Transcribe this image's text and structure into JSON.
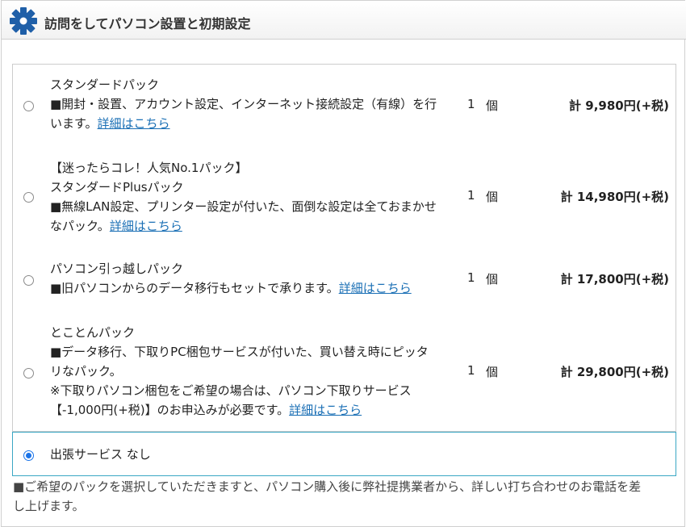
{
  "header": {
    "icon": "gear-icon",
    "title": "訪問をしてパソコン設置と初期設定"
  },
  "options": [
    {
      "name": "スタンダードパック",
      "desc_lines": [
        "■開封・設置、アカウント設定、インターネット接続設定（有線）を行",
        "います。"
      ],
      "link": "詳細はこちら",
      "qty": "1",
      "unit": "個",
      "price": "計 9,980円(+税)",
      "selected": false
    },
    {
      "tagline": "【迷ったらコレ！人気No.1パック】",
      "name": "スタンダードPlusパック",
      "desc_lines": [
        "■無線LAN設定、プリンター設定が付いた、面倒な設定は全ておまかせ",
        "なパック。"
      ],
      "link": "詳細はこちら",
      "qty": "1",
      "unit": "個",
      "price": "計 14,980円(+税)",
      "selected": false
    },
    {
      "name": "パソコン引っ越しパック",
      "desc_lines": [
        "■旧パソコンからのデータ移行もセットで承ります。"
      ],
      "link": "詳細はこちら",
      "qty": "1",
      "unit": "個",
      "price": "計 17,800円(+税)",
      "selected": false
    },
    {
      "name": "とことんパック",
      "desc_lines": [
        "■データ移行、下取りPC梱包サービスが付いた、買い替え時にピッタ",
        "リなパック。",
        "※下取りパソコン梱包をご希望の場合は、パソコン下取りサービス",
        "【-1,000円(+税)】のお申込みが必要です。"
      ],
      "link": "詳細はこちら",
      "qty": "1",
      "unit": "個",
      "price": "計 29,800円(+税)",
      "selected": false
    }
  ],
  "none_option": {
    "label": "出張サービス なし",
    "selected": true
  },
  "footer_note_lines": [
    "■ご希望のパックを選択していただきますと、パソコン購入後に弊社提携業者から、詳しい打ち合わせのお電話を差",
    "し上げます。"
  ],
  "colors": {
    "gear": "#1f5fa8",
    "link": "#1a6fb5",
    "selected_border": "#3aa7c4",
    "radio_selected": "#1a73e8"
  }
}
